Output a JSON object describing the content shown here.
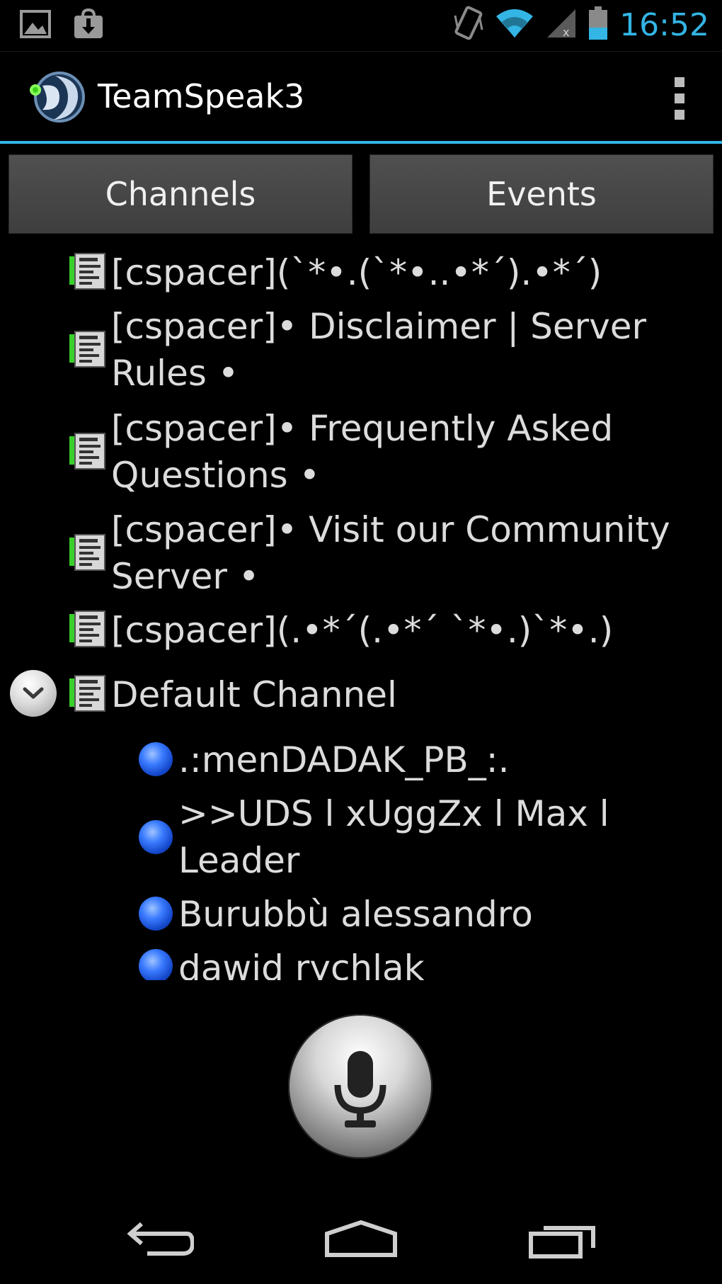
{
  "status_bar": {
    "time": "16:52",
    "icons": [
      "gallery-icon",
      "download-icon",
      "vibrate-icon",
      "wifi-icon",
      "signal-icon",
      "battery-icon"
    ],
    "accent_color": "#33b5e5"
  },
  "action_bar": {
    "title": "TeamSpeak3",
    "overflow_icon": "overflow-menu-icon"
  },
  "tabs": [
    {
      "label": "Channels"
    },
    {
      "label": "Events"
    }
  ],
  "channels": [
    {
      "name": "[cspacer](`*•.(`*•..•*´).•*´)"
    },
    {
      "name": "[cspacer]• Disclaimer | Server Rules •"
    },
    {
      "name": "[cspacer]• Frequently Asked Questions •"
    },
    {
      "name": "[cspacer]• Visit our Community Server •"
    },
    {
      "name": "[cspacer](.•*´(.•*´ `*•.)`*•.)"
    },
    {
      "name": "Default Channel",
      "expanded": true
    }
  ],
  "users": [
    {
      "name": ".:menDADAK_PB_:."
    },
    {
      "name": ">>UDS l xUggZx l Max l Leader"
    },
    {
      "name": "Burubbù alessandro"
    },
    {
      "name": "dawid rychlak"
    }
  ],
  "mic_button": {
    "icon": "microphone-icon"
  },
  "nav_bar": {
    "buttons": [
      "back-icon",
      "home-icon",
      "recent-apps-icon"
    ]
  }
}
